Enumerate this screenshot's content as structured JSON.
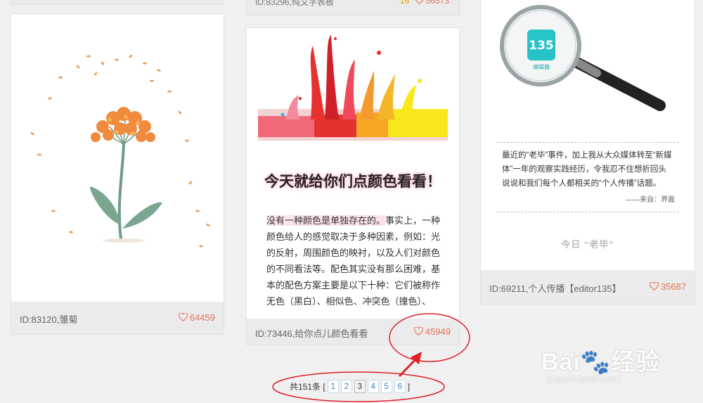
{
  "top_cards": {
    "mid_id": "ID:83296,纯文字表板",
    "mid_likes": "56573",
    "mid_badge": "16"
  },
  "cards": [
    {
      "id_label": "ID:83120,雏菊",
      "likes": "64459"
    },
    {
      "id_label": "ID:73446,给你点儿颜色看看",
      "likes": "45949",
      "headline": "今天就给你们点颜色看看！",
      "body_highlight": "没有一种颜色是单独存在的。",
      "body_rest": "事实上，一种颜色给人的感觉取决于多种因素，例如：光的反射，周围颜色的映衬，以及人们对颜色的不同看法等。配色其实没有那么困难，基本的配色方案主要是以下十种：它们被称作无色（黑白）、相似色、冲突色（撞色）、"
    },
    {
      "id_label": "ID:69211,个人传播【editor135】",
      "likes": "35687",
      "logo_text": "135",
      "logo_sub": "编辑器",
      "quote": "最近的“老毕”事件，加上我从大众媒体转至“新媒体”一年的观察实践经历，令我忍不住想折回头说说和我们每个人都相关的“个人传播”话题。",
      "quote_source": "——来自：界面",
      "today": "今日 “老毕”"
    }
  ],
  "pager": {
    "total_prefix": "共151条 [",
    "suffix": "]",
    "pages": [
      "1",
      "2",
      "3",
      "4",
      "5",
      "6"
    ],
    "current": "3"
  },
  "watermark": {
    "brand": "Bai🐾经验",
    "site": "jingyan.baidu.com"
  },
  "colors": {
    "accent": "#e8715b",
    "link": "#3a8ad6",
    "annotation": "#e0202a"
  }
}
